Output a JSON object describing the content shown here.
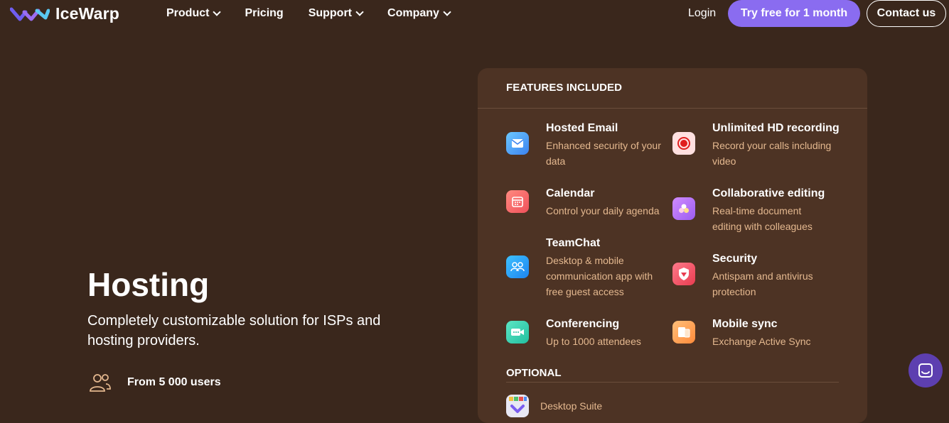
{
  "brand": {
    "name": "IceWarp"
  },
  "nav": {
    "items": [
      {
        "label": "Product",
        "has_dropdown": true
      },
      {
        "label": "Pricing",
        "has_dropdown": false
      },
      {
        "label": "Support",
        "has_dropdown": true
      },
      {
        "label": "Company",
        "has_dropdown": true
      }
    ],
    "login": "Login",
    "cta_try": "Try free for 1 month",
    "cta_contact": "Contact us"
  },
  "hero": {
    "title": "Hosting",
    "subtitle": "Completely customizable solution for ISPs and hosting providers.",
    "users_text": "From 5 000 users"
  },
  "features": {
    "heading": "FEATURES INCLUDED",
    "items": [
      {
        "title": "Hosted Email",
        "desc": "Enhanced security of your data",
        "icon": "mail-icon",
        "color": "#4fa6f0"
      },
      {
        "title": "Unlimited HD recording",
        "desc": "Record your calls including video",
        "icon": "record-icon",
        "color": "#ff5a5a"
      },
      {
        "title": "Calendar",
        "desc": "Control your daily agenda",
        "icon": "calendar-icon",
        "color": "#ff6b6b"
      },
      {
        "title": "Collaborative editing",
        "desc": "Real-time document editing with colleagues",
        "icon": "collab-icon",
        "color": "#b06bf0"
      },
      {
        "title": "TeamChat",
        "desc": "Desktop & mobile communication app with free guest access",
        "icon": "team-icon",
        "color": "#2a9cf0"
      },
      {
        "title": "Security",
        "desc": "Antispam and antivirus protection",
        "icon": "shield-icon",
        "color": "#ff5a6e"
      },
      {
        "title": "Conferencing",
        "desc": "Up to 1000 attendees",
        "icon": "video-icon",
        "color": "#3cd6b0"
      },
      {
        "title": "Mobile sync",
        "desc": "Exchange Active Sync",
        "icon": "devices-icon",
        "color": "#ff9f4a"
      }
    ],
    "optional_heading": "OPTIONAL",
    "optional_items": [
      {
        "label": "Desktop Suite",
        "icon": "desktop-suite-icon"
      }
    ]
  },
  "colors": {
    "background": "#3a271c",
    "card": "#4d3324",
    "accent": "#8a6cf0",
    "desc_text": "#e4b88f"
  }
}
